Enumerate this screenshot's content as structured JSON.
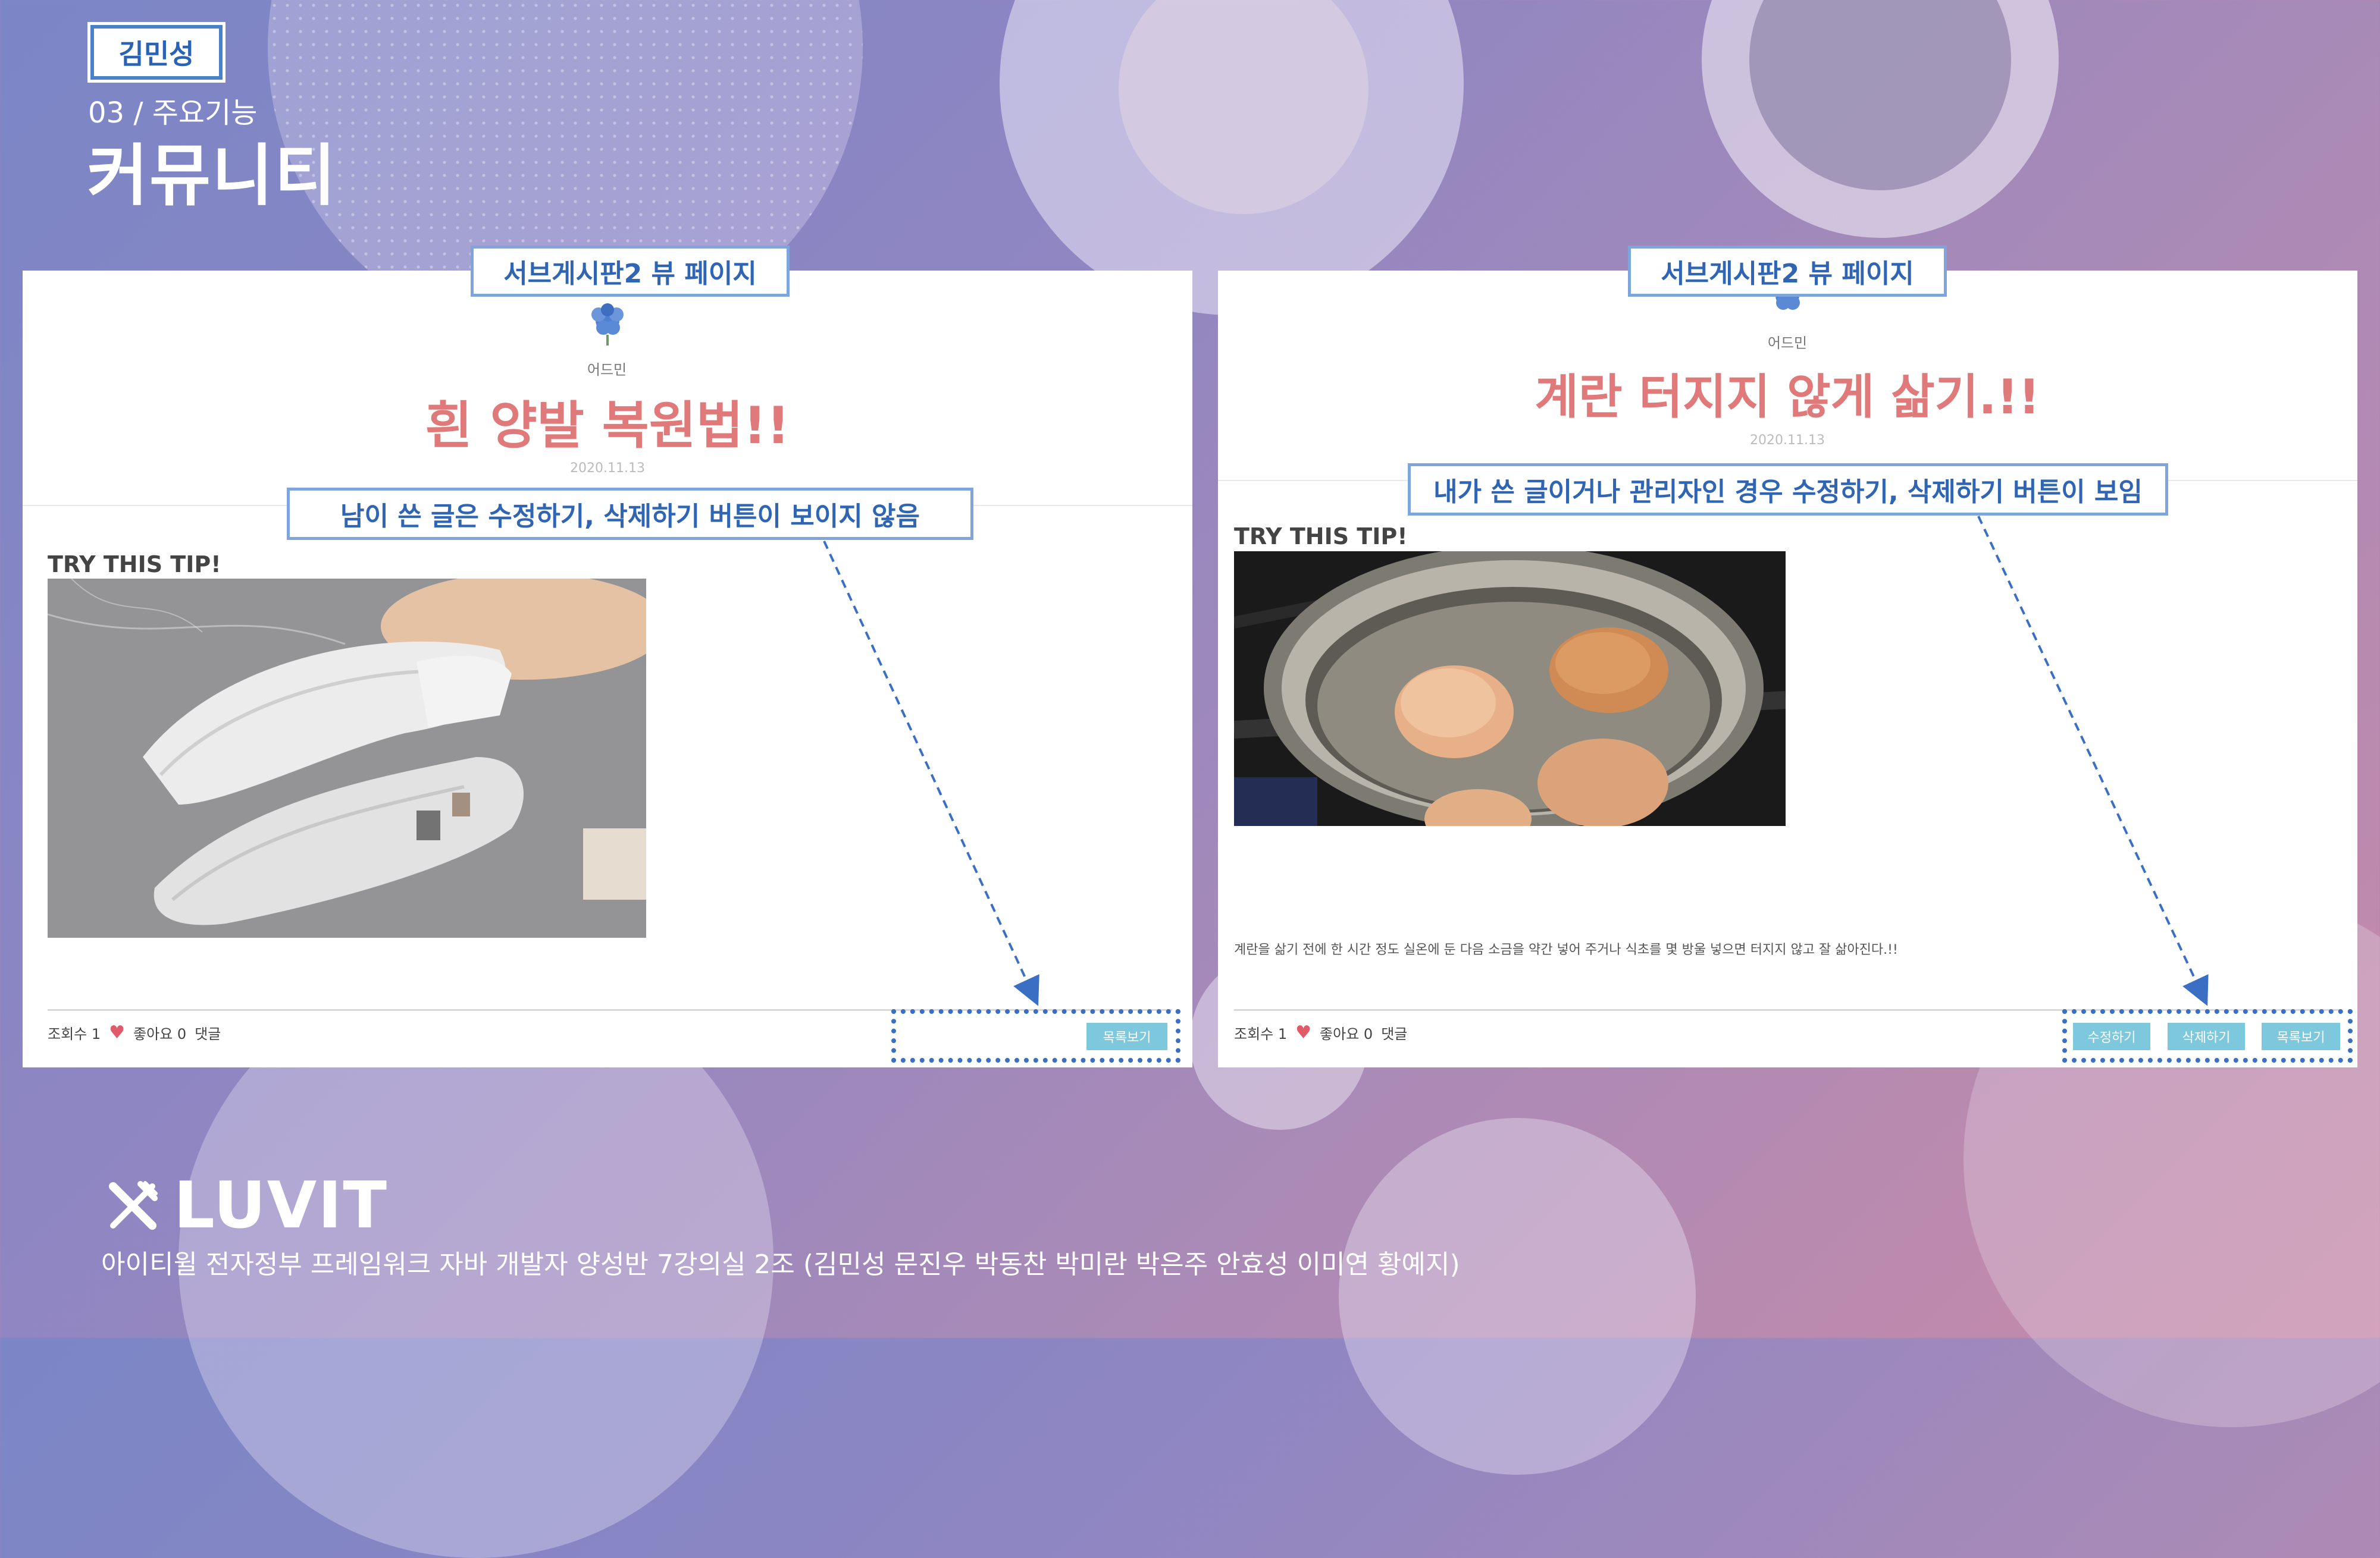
{
  "header": {
    "author": "김민성",
    "section": "03 / 주요기능",
    "title": "커뮤니티"
  },
  "callouts": {
    "left_page": "서브게시판2 뷰 페이지",
    "right_page": "서브게시판2 뷰 페이지",
    "left_note": "남이 쓴 글은 수정하기, 삭제하기 버튼이 보이지 않음",
    "right_note": "내가 쓴 글이거나 관리자인 경우 수정하기, 삭제하기 버튼이 보임"
  },
  "left_post": {
    "author": "어드민",
    "title": "흰 양발 복원법!!",
    "date": "2020.11.13",
    "tip_heading": "TRY THIS TIP!",
    "views": "조회수 1",
    "likes": "좋아요 0",
    "comments": "댓글",
    "list_button": "목록보기"
  },
  "right_post": {
    "author": "어드민",
    "title": "계란 터지지 않게 삶기.!!",
    "date": "2020.11.13",
    "tip_heading": "TRY THIS TIP!",
    "body": "계란을 삶기 전에 한 시간 정도 실온에 둔 다음 소금을 약간 넣어 주거나 식초를 몇 방울 넣으면 터지지 않고 잘 삶아진다.!!",
    "views": "조회수 1",
    "likes": "좋아요 0",
    "comments": "댓글",
    "edit_button": "수정하기",
    "delete_button": "삭제하기",
    "list_button": "목록보기"
  },
  "footer": {
    "brand": "LUVIT",
    "credits": "아이티윌 전자정부 프레임워크 자바 개발자 양성반 7강의실 2조 (김민성 문진우 박동찬 박미란 박은주 안효성 이미연 황예지)"
  },
  "colors": {
    "callout_text": "#2f65b3",
    "callout_border": "#7fa6dc",
    "post_title": "#e07a7a",
    "button": "#7ec8de",
    "dashed_highlight": "#3a6fc4"
  }
}
